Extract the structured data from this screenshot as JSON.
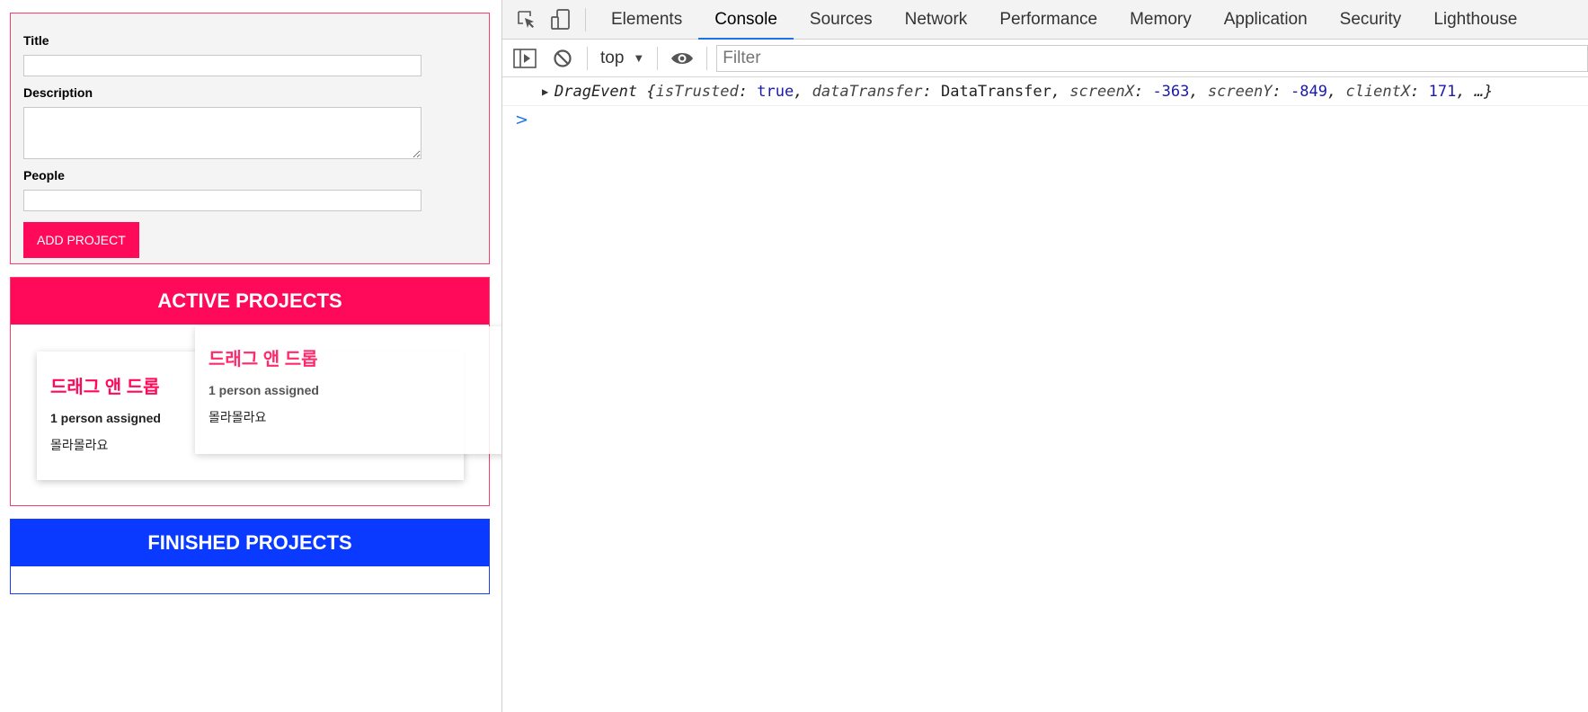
{
  "form": {
    "title_label": "Title",
    "title_value": "",
    "description_label": "Description",
    "description_value": "",
    "people_label": "People",
    "people_value": "",
    "submit_label": "ADD PROJECT"
  },
  "active_projects": {
    "header": "ACTIVE PROJECTS",
    "cards": [
      {
        "title": "드래그 앤 드롭",
        "people": "1 person assigned",
        "description": "몰라몰라요"
      }
    ]
  },
  "drag_ghost": {
    "title": "드래그 앤 드롭",
    "people": "1 person assigned",
    "description": "몰라몰라요"
  },
  "finished_projects": {
    "header": "FINISHED PROJECTS"
  },
  "devtools": {
    "tabs": [
      {
        "label": "Elements",
        "active": false
      },
      {
        "label": "Console",
        "active": true
      },
      {
        "label": "Sources",
        "active": false
      },
      {
        "label": "Network",
        "active": false
      },
      {
        "label": "Performance",
        "active": false
      },
      {
        "label": "Memory",
        "active": false
      },
      {
        "label": "Application",
        "active": false
      },
      {
        "label": "Security",
        "active": false
      },
      {
        "label": "Lighthouse",
        "active": false
      }
    ],
    "context": "top",
    "filter_placeholder": "Filter",
    "log": {
      "class_name": "DragEvent",
      "open_brace": "{",
      "fields": [
        {
          "key": "isTrusted",
          "value": "true",
          "kind": "bool"
        },
        {
          "key": "dataTransfer",
          "value": "DataTransfer",
          "kind": "obj"
        },
        {
          "key": "screenX",
          "value": "-363",
          "kind": "num"
        },
        {
          "key": "screenY",
          "value": "-849",
          "kind": "num"
        },
        {
          "key": "clientX",
          "value": "171",
          "kind": "num"
        }
      ],
      "ellipsis": "…}"
    },
    "prompt_symbol": ">"
  },
  "colors": {
    "accent_pink": "#ff0a5a",
    "accent_blue": "#0a3aff",
    "devtools_active_tab": "#1a73e8"
  },
  "icons": [
    "inspect-element-icon",
    "device-toolbar-icon",
    "sidebar-toggle-icon",
    "clear-console-icon",
    "eye-icon"
  ]
}
